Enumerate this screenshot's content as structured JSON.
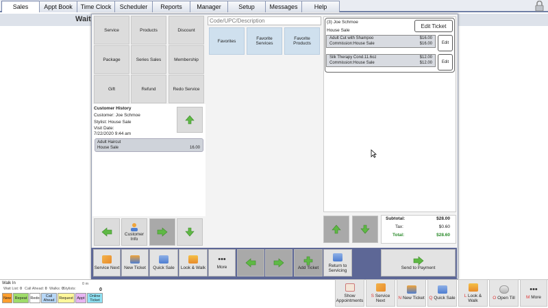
{
  "tabs": [
    "Sales",
    "Appt Book",
    "Time Clock",
    "Scheduler",
    "Reports",
    "Manager",
    "Setup",
    "Messages",
    "Help"
  ],
  "background": {
    "wait_label": "Wait"
  },
  "categories": [
    "Service",
    "Products",
    "Discount",
    "Package",
    "Series Sales",
    "Membership",
    "Gift",
    "Refund",
    "Redo Service"
  ],
  "search": {
    "placeholder": "Code/UPC/Description"
  },
  "favorites": [
    "Favorites",
    "Favorite Services",
    "Favorite Products"
  ],
  "history": {
    "title": "Customer History",
    "customer": "Customer: Joe Schmoe",
    "stylist": "Stylist: House Sale",
    "visit_label": "Visit Date:",
    "visit_date": "7/22/2020 9:44 am",
    "item_name": "Adult Haircut",
    "item_sub": "House Sale",
    "item_price": "16.00"
  },
  "left_nav": {
    "customer_info": "Customer Info"
  },
  "ticket": {
    "title": "(3) Joe Schmoe",
    "subtitle": "House Sale",
    "edit_label": "Edit Ticket",
    "items": [
      {
        "name": "Adult Cut with Shampoo",
        "price": "$16.00",
        "commission": "Commission:House Sale",
        "price2": "$16.00",
        "edit": "Edit"
      },
      {
        "name": "Silk Therapy Cond.11.6oz",
        "price": "$12.00",
        "commission": "Commission:House Sale",
        "price2": "$12.00",
        "edit": "Edit"
      }
    ]
  },
  "totals": {
    "subtotal_label": "Subtotal:",
    "subtotal": "$28.00",
    "tax_label": "Tax:",
    "tax": "$0.60",
    "total_label": "Total:",
    "total": "$28.60"
  },
  "actions": [
    "Service Next",
    "New Ticket",
    "Quick Sale",
    "Look & Walk",
    "More"
  ],
  "actions2": {
    "add_ticket": "Add Ticket",
    "return": "Return to Servicing",
    "send": "Send to Payment"
  },
  "status": {
    "walk_in": "Walk In",
    "wait_list": "Wait List:",
    "wait_list_val": "0",
    "call_ahead": "Call Ahead:",
    "call_ahead_val": "0",
    "walks": "Walks:",
    "walks_val": "0",
    "stylists": "Stylists:",
    "minutes": "0 m",
    "count": "0"
  },
  "pills": [
    "New",
    "Repeat",
    "Redo",
    "Call Ahead",
    "Request",
    "Appt",
    "Online Ticket"
  ],
  "bottom": [
    {
      "hk": "",
      "label": "Show Appointments"
    },
    {
      "hk": "S",
      "label": "Service Next"
    },
    {
      "hk": "N",
      "label": "New Ticket"
    },
    {
      "hk": "Q",
      "label": "Quick Sale"
    },
    {
      "hk": "L",
      "label": "Look & Walk"
    },
    {
      "hk": "O",
      "label": "Open Till"
    },
    {
      "hk": "M",
      "label": "More"
    }
  ],
  "colors": {
    "accent": "#5d6796",
    "favorite": "#cfe0ee",
    "green_arrow": "#5fb845",
    "pill_new": "#ff9f2e",
    "pill_repeat": "#9fdc6a",
    "pill_redo": "#ffffff",
    "pill_callahead": "#b7d7f7",
    "pill_request": "#fff79b",
    "pill_appt": "#e7b5f2",
    "pill_online": "#8fe3f5"
  }
}
